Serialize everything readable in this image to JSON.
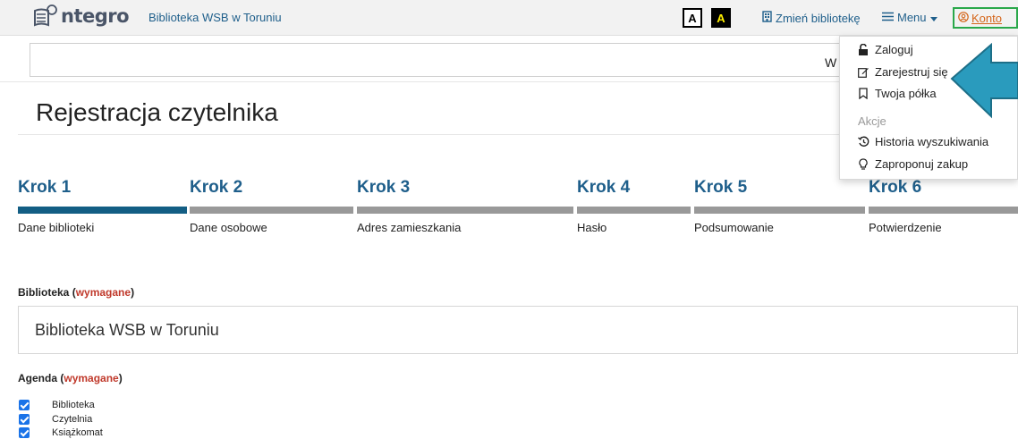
{
  "header": {
    "logo_text": "ntegro",
    "library_name": "Biblioteka WSB w Toruniu",
    "contrast_normal": "A",
    "contrast_high": "A",
    "change_library": "Zmień bibliotekę",
    "menu": "Menu",
    "account": "Konto"
  },
  "search": {
    "value": "",
    "partial_text": "W"
  },
  "page": {
    "title": "Rejestracja czytelnika"
  },
  "steps": [
    {
      "title": "Krok 1",
      "label": "Dane biblioteki",
      "active": true
    },
    {
      "title": "Krok 2",
      "label": "Dane osobowe",
      "active": false
    },
    {
      "title": "Krok 3",
      "label": "Adres zamieszkania",
      "active": false
    },
    {
      "title": "Krok 4",
      "label": "Hasło",
      "active": false
    },
    {
      "title": "Krok 5",
      "label": "Podsumowanie",
      "active": false
    },
    {
      "title": "Krok 6",
      "label": "Potwierdzenie",
      "active": false
    }
  ],
  "form": {
    "library_label": "Biblioteka",
    "required_text": "wymagane",
    "library_value": "Biblioteka WSB w Toruniu",
    "agenda_label": "Agenda",
    "agenda_options": [
      {
        "label": "Biblioteka",
        "checked": true
      },
      {
        "label": "Czytelnia",
        "checked": true
      },
      {
        "label": "Książkomat",
        "checked": true
      }
    ]
  },
  "account_menu": {
    "login": "Zaloguj",
    "register": "Zarejestruj się",
    "shelf": "Twoja półka",
    "actions_header": "Akcje",
    "history": "Historia wyszukiwania",
    "suggest": "Zaproponuj zakup"
  },
  "colors": {
    "link": "#1f5f8b",
    "active_step": "#135e84",
    "inactive_step": "#999999",
    "required": "#c0392b",
    "account": "#d4651a",
    "account_border": "#2aa84a",
    "arrow": "#2a9bbd"
  }
}
